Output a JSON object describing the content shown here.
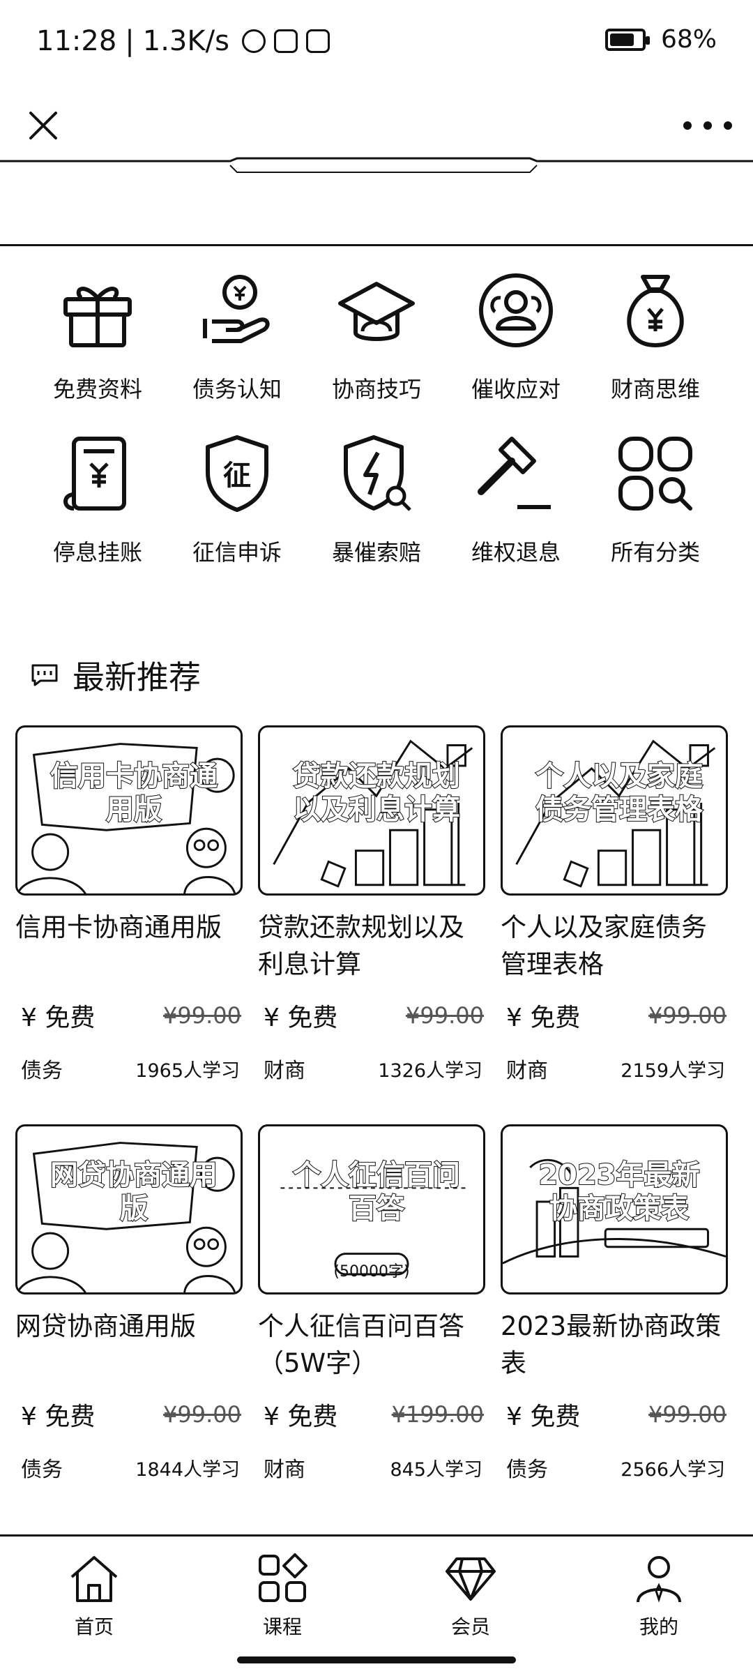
{
  "status_bar": {
    "time": "11:28",
    "speed": "1.3K/s",
    "battery": "68%",
    "battery_level": 0.68
  },
  "nav": {
    "title": "",
    "close_icon": "close-icon",
    "more_icon": "more-icon"
  },
  "page_title": "",
  "categories": [
    {
      "label": "免费资料",
      "icon": "gift-icon"
    },
    {
      "label": "债务认知",
      "icon": "hand-coin-icon"
    },
    {
      "label": "协商技巧",
      "icon": "graduation-cap-icon"
    },
    {
      "label": "催收应对",
      "icon": "users-circle-icon"
    },
    {
      "label": "财商思维",
      "icon": "money-bag-icon"
    },
    {
      "label": "停息挂账",
      "icon": "document-yen-icon"
    },
    {
      "label": "征信申诉",
      "icon": "shield-icon"
    },
    {
      "label": "暴催索赔",
      "icon": "shield-bolt-icon"
    },
    {
      "label": "维权退息",
      "icon": "gavel-icon"
    },
    {
      "label": "所有分类",
      "icon": "grid-search-icon"
    }
  ],
  "section": {
    "title": "最新推荐"
  },
  "courses": [
    {
      "thumb_text": "信用卡协商通用版",
      "thumb_sub": "",
      "title": "信用卡协商通用版",
      "price": "¥ 免费",
      "orig_price": "¥99.00",
      "tag": "债务",
      "learners": "1965人学习"
    },
    {
      "thumb_text": "贷款还款规划以及利息计算",
      "thumb_sub": "",
      "title": "贷款还款规划以及利息计算",
      "price": "¥ 免费",
      "orig_price": "¥99.00",
      "tag": "财商",
      "learners": "1326人学习"
    },
    {
      "thumb_text": "个人以及家庭债务管理表格",
      "thumb_sub": "",
      "title": "个人以及家庭债务管理表格",
      "price": "¥ 免费",
      "orig_price": "¥99.00",
      "tag": "财商",
      "learners": "2159人学习"
    },
    {
      "thumb_text": "网贷协商通用版",
      "thumb_sub": "",
      "title": "网贷协商通用版",
      "price": "¥ 免费",
      "orig_price": "¥99.00",
      "tag": "债务",
      "learners": "1844人学习"
    },
    {
      "thumb_text": "个人征信百问百答",
      "thumb_sub": "(50000字)",
      "title": "个人征信百问百答（5W字）",
      "price": "¥ 免费",
      "orig_price": "¥199.00",
      "tag": "财商",
      "learners": "845人学习"
    },
    {
      "thumb_text": "2023年最新协商政策表",
      "thumb_sub": "",
      "title": "2023最新协商政策表",
      "price": "¥ 免费",
      "orig_price": "¥99.00",
      "tag": "债务",
      "learners": "2566人学习"
    }
  ],
  "bottom_nav": [
    {
      "label": "首页",
      "icon": "home-icon"
    },
    {
      "label": "课程",
      "icon": "courses-icon"
    },
    {
      "label": "会员",
      "icon": "diamond-icon"
    },
    {
      "label": "我的",
      "icon": "profile-icon"
    }
  ]
}
